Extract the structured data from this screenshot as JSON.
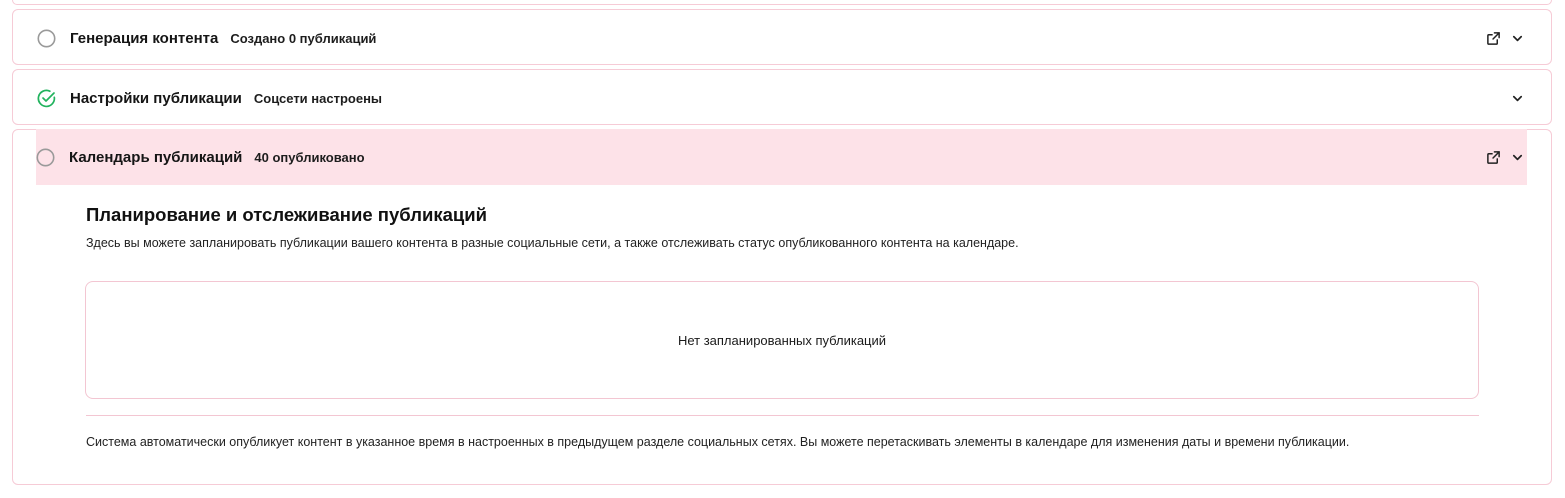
{
  "steps": [
    {
      "title": "Генерация контента",
      "subtitle": "Создано 0 публикаций",
      "status": "pending",
      "has_external_link": true
    },
    {
      "title": "Настройки публикации",
      "subtitle": "Соцсети настроены",
      "status": "done",
      "has_external_link": false
    },
    {
      "title": "Календарь публикаций",
      "subtitle": "40 опубликовано",
      "status": "pending",
      "has_external_link": true,
      "expanded": true
    }
  ],
  "calendar": {
    "heading": "Планирование и отслеживание публикаций",
    "description": "Здесь вы можете запланировать публикации вашего контента в разные социальные сети, а также отслеживать статус опубликованного контента на календаре.",
    "empty_state": "Нет запланированных публикаций",
    "footer_note": "Система автоматически опубликует контент в указанное время в настроенных в предыдущем разделе социальных сетях. Вы можете перетаскивать элементы в календаре для изменения даты и времени публикации."
  },
  "colors": {
    "border": "#f6cbd6",
    "highlight": "#fde2e8",
    "done": "#22b35e",
    "pending": "#9a9a9a"
  },
  "icons": {
    "pending": "circle-outline-icon",
    "done": "check-circle-icon",
    "external": "external-link-icon",
    "expand": "chevron-down-icon"
  }
}
